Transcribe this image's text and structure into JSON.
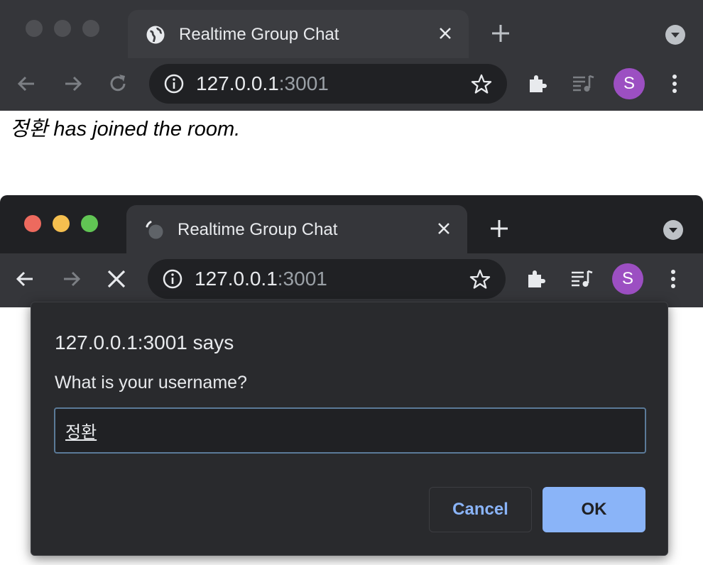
{
  "back_window": {
    "tab": {
      "title": "Realtime Group Chat",
      "favicon": "globe-icon"
    },
    "omnibox": {
      "host": "127.0.0.1",
      "port": ":3001"
    },
    "avatar_letter": "S",
    "page": {
      "message": "정환 has joined the room."
    }
  },
  "front_window": {
    "tab": {
      "title": "Realtime Group Chat",
      "favicon": "loading-spinner-icon"
    },
    "omnibox": {
      "host": "127.0.0.1",
      "port": ":3001"
    },
    "avatar_letter": "S"
  },
  "dialog": {
    "title": "127.0.0.1:3001 says",
    "message": "What is your username?",
    "input_value": "정환",
    "cancel_label": "Cancel",
    "ok_label": "OK"
  },
  "colors": {
    "chrome_dark": "#202124",
    "toolbar": "#35363a",
    "accent_blue": "#8ab4f8",
    "avatar_purple": "#9c4fc2",
    "traffic_red": "#ed6a5e",
    "traffic_yellow": "#f5bf4f",
    "traffic_green": "#61c554"
  }
}
